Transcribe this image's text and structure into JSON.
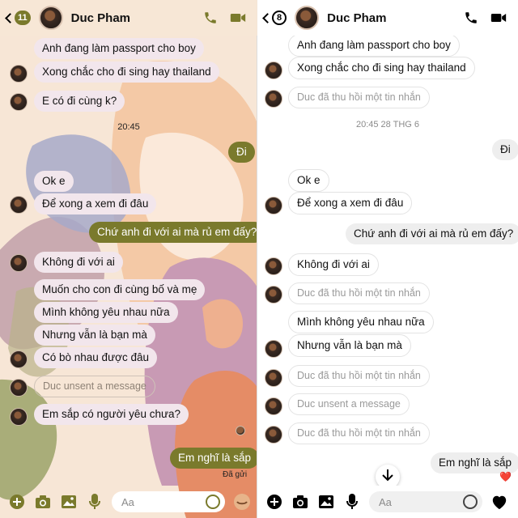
{
  "left": {
    "contact_name": "Duc Pham",
    "unread_count": "11",
    "timestamp": "20:45",
    "status": "Đã gửi",
    "input_placeholder": "Aa",
    "messages": [
      {
        "text": "Anh đang làm passport cho boy"
      },
      {
        "text": "Xong chắc cho đi sing hay thailand"
      },
      {
        "text": "E có đi cùng k?"
      },
      {
        "text": "Đi"
      },
      {
        "text": "Ok e"
      },
      {
        "text": "Để xong a xem đi đâu"
      },
      {
        "text": "Chứ anh đi với ai mà rủ em đấy?"
      },
      {
        "text": "Không đi với ai"
      },
      {
        "text": "Muốn cho con đi cùng bố và mẹ"
      },
      {
        "text": "Mình không yêu nhau nữa"
      },
      {
        "text": "Nhưng vẫn là bạn mà"
      },
      {
        "text": "Có bò nhau được đâu"
      },
      {
        "text": "Duc unsent a message"
      },
      {
        "text": "Em sắp có người yêu chưa?"
      },
      {
        "text": "Em nghĩ là sắp"
      }
    ]
  },
  "right": {
    "contact_name": "Duc Pham",
    "unread_count": "8",
    "timestamp": "20:45 28 THG 6",
    "input_placeholder": "Aa",
    "reaction": "❤️",
    "messages": [
      {
        "text": "Anh đang làm passport cho boy"
      },
      {
        "text": "Xong chắc cho đi sing hay thailand"
      },
      {
        "text": "Duc đã thu hồi một tin nhắn"
      },
      {
        "text": "Đi"
      },
      {
        "text": "Ok e"
      },
      {
        "text": "Để xong a xem đi đâu"
      },
      {
        "text": "Chứ anh đi với ai mà rủ em đấy?"
      },
      {
        "text": "Không đi với ai"
      },
      {
        "text": "Duc đã thu hồi một tin nhắn"
      },
      {
        "text": "Mình không yêu nhau nữa"
      },
      {
        "text": "Nhưng vẫn là bạn mà"
      },
      {
        "text": "Duc đã thu hồi một tin nhắn"
      },
      {
        "text": "Duc unsent a message"
      },
      {
        "text": "Duc đã thu hồi một tin nhắn"
      },
      {
        "text": "Em nghĩ là sắp"
      }
    ]
  },
  "colors": {
    "left_background": "#f7e6d6",
    "left_outgoing_bubble": "#7a7a2c",
    "left_incoming_bubble": "#f2e6ec",
    "right_outgoing_bubble": "#eeeeee",
    "heart": "#e0245e"
  },
  "icons": [
    "back-chevron-icon",
    "phone-icon",
    "video-camera-icon",
    "plus-icon",
    "camera-icon",
    "gallery-icon",
    "microphone-icon",
    "emoji-icon",
    "heart-icon",
    "arrow-down-icon"
  ]
}
